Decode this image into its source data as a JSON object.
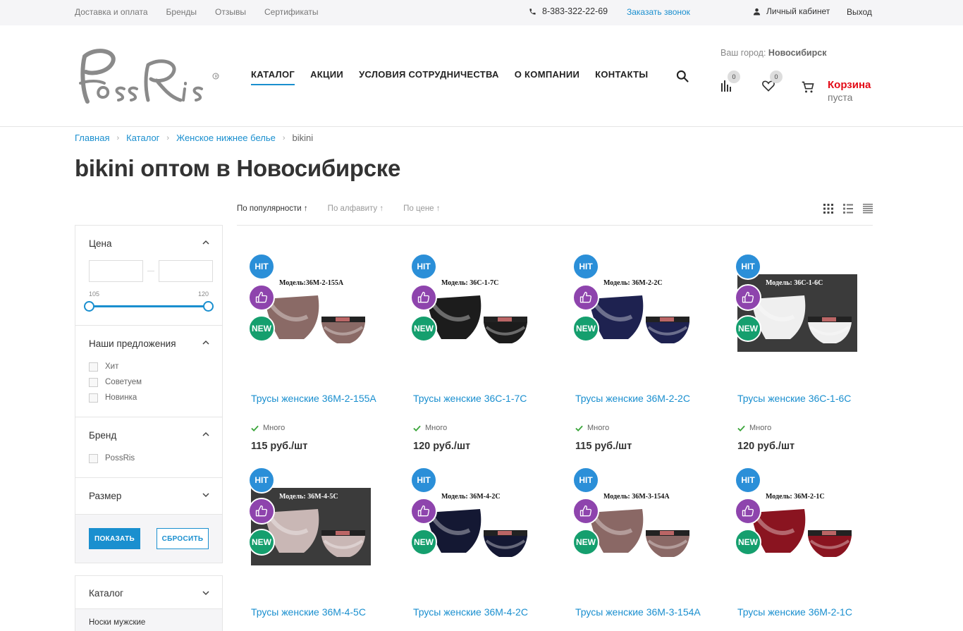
{
  "topbar": {
    "links": [
      "Доставка и оплата",
      "Бренды",
      "Отзывы",
      "Сертификаты"
    ],
    "phone": "8-383-322-22-69",
    "callback": "Заказать звонок",
    "cabinet": "Личный кабинет",
    "logout": "Выход"
  },
  "header": {
    "logo_text": "PossRis",
    "nav": [
      "КАТАЛОГ",
      "АКЦИИ",
      "УСЛОВИЯ СОТРУДНИЧЕСТВА",
      "О КОМПАНИИ",
      "КОНТАКТЫ"
    ],
    "city_label": "Ваш город:",
    "city_value": "Новосибирск",
    "compare_count": "0",
    "favorites_count": "0",
    "cart_title": "Корзина",
    "cart_sub": "пуста"
  },
  "breadcrumbs": [
    "Главная",
    "Каталог",
    "Женское нижнее белье",
    "bikini"
  ],
  "page_title": "bikini оптом в Новосибирске",
  "sort": {
    "options": [
      "По популярности ↑",
      "По алфавиту ↑",
      "По цене ↑"
    ],
    "active_index": 0
  },
  "filter": {
    "price_title": "Цена",
    "price_min_label": "105",
    "price_max_label": "120",
    "offers_title": "Наши предложения",
    "offers": [
      "Хит",
      "Советуем",
      "Новинка"
    ],
    "brand_title": "Бренд",
    "brands": [
      "PossRis"
    ],
    "size_title": "Размер",
    "show_button": "ПОКАЗАТЬ",
    "reset_button": "СБРОСИТЬ"
  },
  "catalog_menu": {
    "title": "Каталог",
    "first_item": "Носки мужские"
  },
  "badges": {
    "hit": "HIT",
    "new": "NEW"
  },
  "products": [
    {
      "name": "Трусы женские 36М-2-155А",
      "model": "Модель:36М-2-155А",
      "stock": "Много",
      "price": "115 руб./шт",
      "color": "#8a6a66",
      "dark_bg": false
    },
    {
      "name": "Трусы женские 36С-1-7С",
      "model": "Модель: 36С-1-7С",
      "stock": "Много",
      "price": "120 руб./шт",
      "color": "#1c1c1c",
      "dark_bg": false
    },
    {
      "name": "Трусы женские 36М-2-2С",
      "model": "Модель: 36М-2-2С",
      "stock": "Много",
      "price": "115 руб./шт",
      "color": "#1e2250",
      "dark_bg": false
    },
    {
      "name": "Трусы женские 36С-1-6С",
      "model": "Модель: 36С-1-6С",
      "stock": "Много",
      "price": "120 руб./шт",
      "color": "#efefef",
      "dark_bg": true
    },
    {
      "name": "Трусы женские 36М-4-5С",
      "model": "Модель: 36М-4-5С",
      "stock": "",
      "price": "",
      "color": "#c9b7b5",
      "dark_bg": true
    },
    {
      "name": "Трусы женские 36М-4-2С",
      "model": "Модель: 36М-4-2С",
      "stock": "",
      "price": "",
      "color": "#141833",
      "dark_bg": false
    },
    {
      "name": "Трусы женские 36М-3-154А",
      "model": "Модель: 36М-3-154А",
      "stock": "",
      "price": "",
      "color": "#8a6865",
      "dark_bg": false
    },
    {
      "name": "Трусы женские 36М-2-1С",
      "model": "Модель: 36М-2-1С",
      "stock": "",
      "price": "",
      "color": "#8a1420",
      "dark_bg": false
    }
  ]
}
